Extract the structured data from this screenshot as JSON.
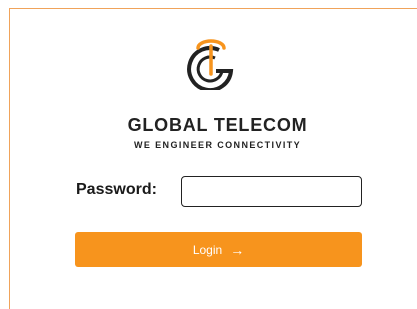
{
  "brand": {
    "name": "GLOBAL TELECOM",
    "tagline": "WE ENGINEER CONNECTIVITY",
    "accent_color": "#f7941d",
    "logo_icon": "global-telecom-logo-icon"
  },
  "form": {
    "password_label": "Password:",
    "password_value": "",
    "login_label": "Login",
    "login_icon": "arrow-right-icon",
    "login_arrow_glyph": "→"
  }
}
